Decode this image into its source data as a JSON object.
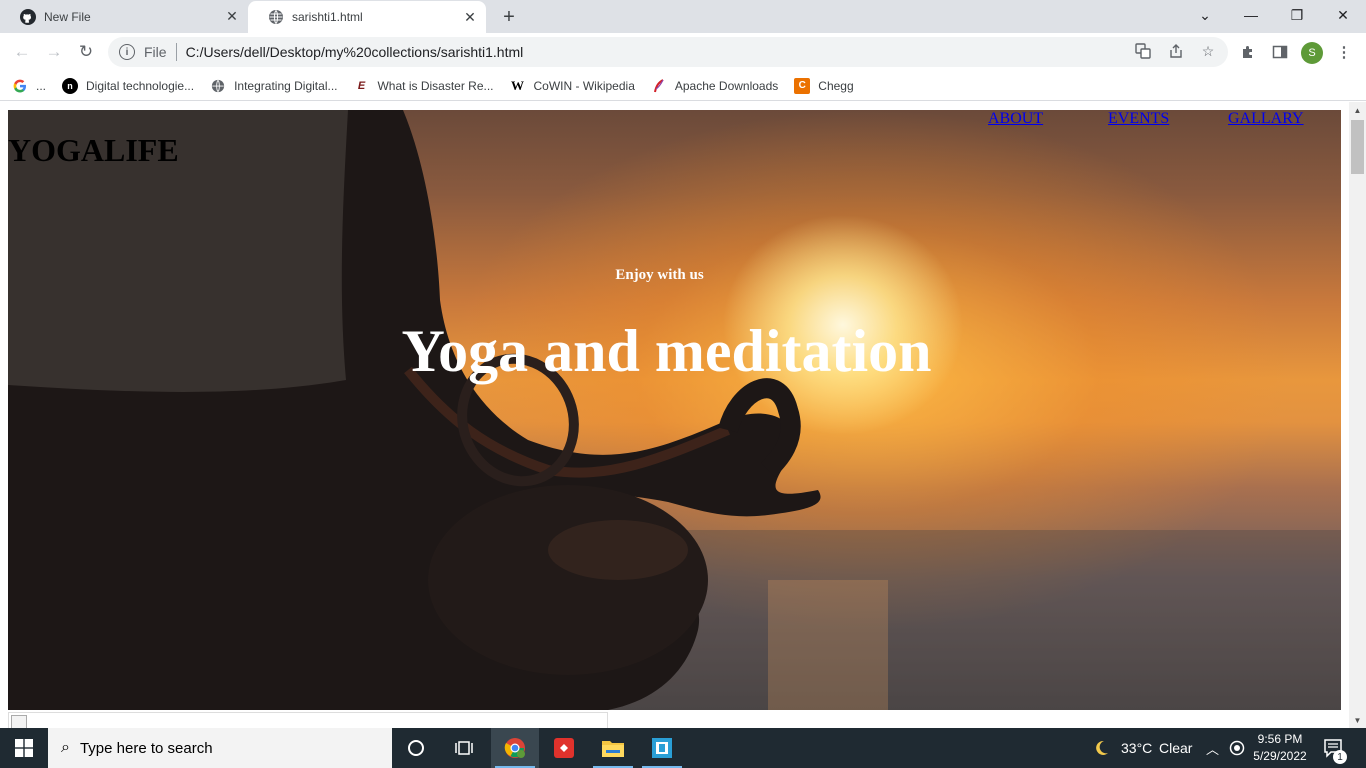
{
  "browser": {
    "tabs": [
      {
        "title": "New File",
        "icon": "github-icon",
        "active": false
      },
      {
        "title": "sarishti1.html",
        "icon": "globe-icon",
        "active": true
      }
    ],
    "address": {
      "scheme_label": "File",
      "url": "C:/Users/dell/Desktop/my%20collections/sarishti1.html"
    },
    "profile_initial": "S",
    "bookmarks": [
      {
        "label": "...",
        "icon": "google-icon"
      },
      {
        "label": "Digital technologie...",
        "icon": "n-icon"
      },
      {
        "label": "Integrating Digital...",
        "icon": "globe-icon"
      },
      {
        "label": "What is Disaster Re...",
        "icon": "e-icon"
      },
      {
        "label": "CoWIN - Wikipedia",
        "icon": "wikipedia-icon"
      },
      {
        "label": "Apache Downloads",
        "icon": "feather-icon"
      },
      {
        "label": "Chegg",
        "icon": "chegg-icon"
      }
    ]
  },
  "page": {
    "logo": "YOGALIFE",
    "nav": [
      "ABOUT",
      "EVENTS",
      "GALLARY"
    ],
    "hero_subtitle": "Enjoy with us",
    "hero_title": "Yoga and meditation"
  },
  "taskbar": {
    "search_placeholder": "Type here to search",
    "weather_temp": "33°C",
    "weather_desc": "Clear",
    "time": "9:56 PM",
    "date": "5/29/2022",
    "notification_count": "1"
  },
  "colors": {
    "link": "#0000ee",
    "tab_strip": "#dee1e6",
    "taskbar": "#1f2a32",
    "profile": "#5e9a38"
  }
}
